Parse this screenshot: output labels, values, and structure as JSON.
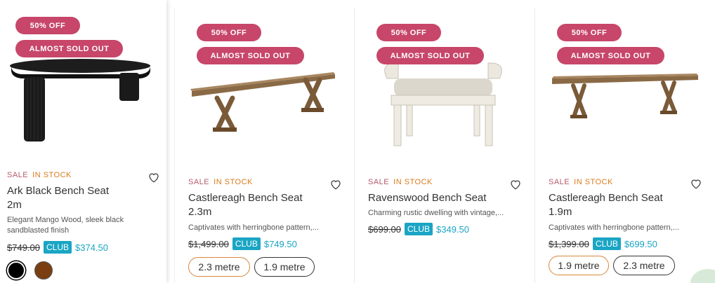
{
  "products": [
    {
      "badges": [
        "50% OFF",
        "ALMOST SOLD OUT"
      ],
      "sale": "SALE",
      "stock": "IN STOCK",
      "title": "Ark Black Bench Seat 2m",
      "description": "Elegant Mango Wood, sleek black sandblasted finish",
      "old_price": "$749.00",
      "club_label": "CLUB",
      "club_price": "$374.50",
      "swatches": [
        "#000000",
        "#7a3e10"
      ]
    },
    {
      "badges": [
        "50% OFF",
        "ALMOST SOLD OUT"
      ],
      "sale": "SALE",
      "stock": "IN STOCK",
      "title": "Castlereagh Bench Seat 2.3m",
      "description": "Captivates with herringbone pattern,...",
      "old_price": "$1,499.00",
      "club_label": "CLUB",
      "club_price": "$749.50",
      "options": [
        "2.3 metre",
        "1.9 metre"
      ]
    },
    {
      "badges": [
        "50% OFF",
        "ALMOST SOLD OUT"
      ],
      "sale": "SALE",
      "stock": "IN STOCK",
      "title": "Ravenswood Bench Seat",
      "description": "Charming rustic dwelling with vintage,...",
      "old_price": "$699.00",
      "club_label": "CLUB",
      "club_price": "$349.50"
    },
    {
      "badges": [
        "50% OFF",
        "ALMOST SOLD OUT"
      ],
      "sale": "SALE",
      "stock": "IN STOCK",
      "title": "Castlereagh Bench Seat 1.9m",
      "description": "Captivates with herringbone pattern,...",
      "old_price": "$1,399.00",
      "club_label": "CLUB",
      "club_price": "$699.50",
      "options": [
        "1.9 metre",
        "2.3 metre"
      ]
    }
  ],
  "colors": {
    "badge": "#c7466a",
    "club": "#1aa5c4",
    "stock": "#d97a1a",
    "sale": "#b55a6c",
    "active_option": "#d9863a"
  },
  "icons": [
    "heart-icon"
  ]
}
